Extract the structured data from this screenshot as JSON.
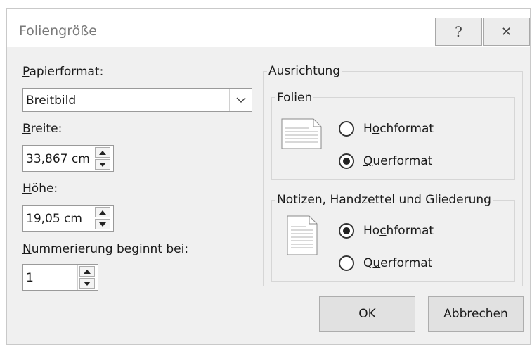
{
  "window": {
    "title": "Foliengröße"
  },
  "titlebar": {
    "help_glyph": "?",
    "close_glyph": "✕"
  },
  "left": {
    "papierformat_label_accel": "P",
    "papierformat_label_rest": "apierformat:",
    "papierformat_value": "Breitbild",
    "breite_label_accel": "B",
    "breite_label_rest": "reite:",
    "breite_value": "33,867 cm",
    "hoehe_label_accel": "H",
    "hoehe_label_rest": "öhe:",
    "hoehe_value": "19,05 cm",
    "nummerierung_label_accel": "N",
    "nummerierung_label_rest": "ummerierung beginnt bei:",
    "nummerierung_value": "1"
  },
  "ausrichtung": {
    "title": "Ausrichtung",
    "folien": {
      "title": "Folien",
      "hoch": {
        "pre": "H",
        "accel": "o",
        "post": "chformat",
        "checked": false
      },
      "quer": {
        "pre": "",
        "accel": "Q",
        "post": "uerformat",
        "checked": true
      }
    },
    "notizen": {
      "title": "Notizen, Handzettel und Gliederung",
      "hoch": {
        "pre": "Ho",
        "accel": "c",
        "post": "hformat",
        "checked": true
      },
      "quer": {
        "pre": "Q",
        "accel": "u",
        "post": "erformat",
        "checked": false
      }
    }
  },
  "buttons": {
    "ok": "OK",
    "cancel": "Abbrechen"
  },
  "colors": {
    "dialog_bg": "#f0f0f0",
    "titlebar_bg": "#ffffff",
    "title_text": "#7a7a7a"
  }
}
